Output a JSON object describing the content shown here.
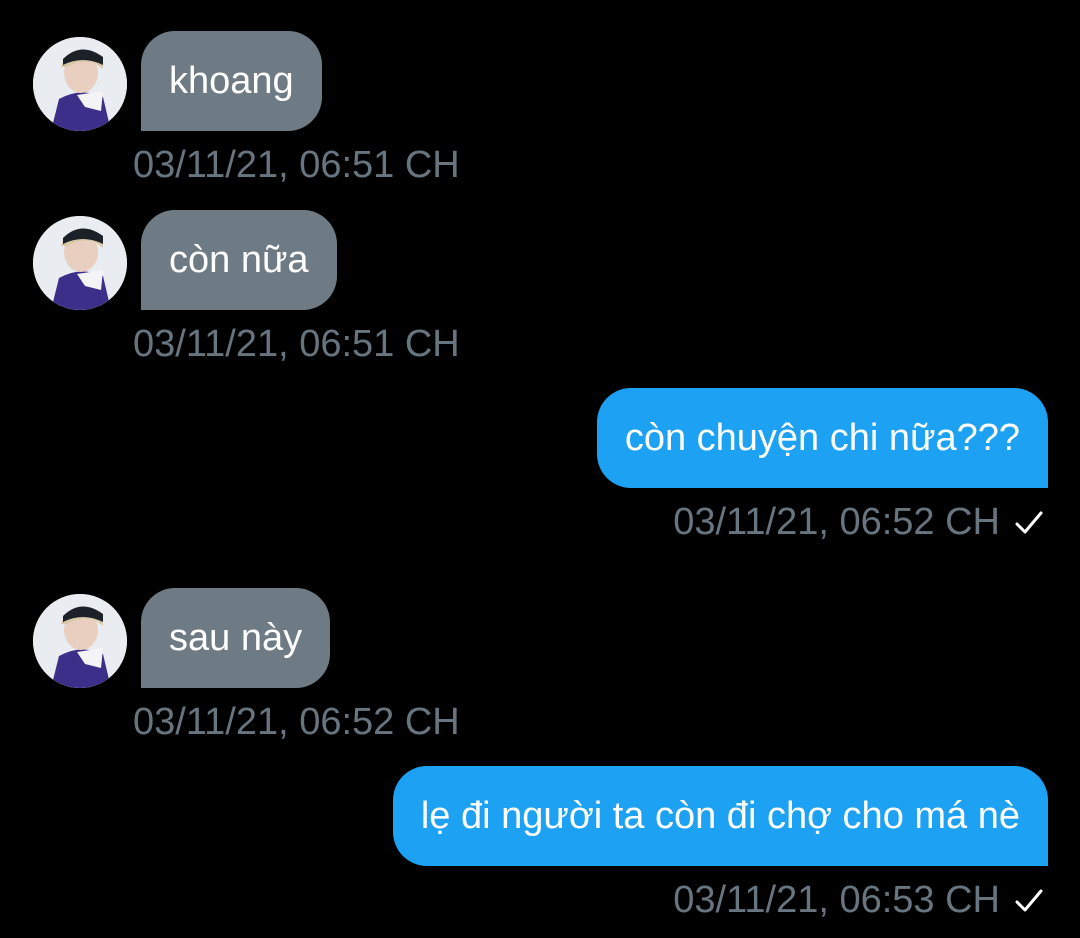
{
  "colors": {
    "background": "#000000",
    "incoming_bubble": "#6e7b85",
    "outgoing_bubble": "#1da1f2",
    "timestamp": "#66757f",
    "text": "#ffffff"
  },
  "messages": [
    {
      "direction": "incoming",
      "text": "khoang",
      "timestamp": "03/11/21, 06:51 CH",
      "avatar": "contact-avatar"
    },
    {
      "direction": "incoming",
      "text": "còn nữa",
      "timestamp": "03/11/21, 06:51 CH",
      "avatar": "contact-avatar"
    },
    {
      "direction": "outgoing",
      "text": "còn chuyện chi nữa???",
      "timestamp": "03/11/21, 06:52 CH",
      "status_icon": "check-icon"
    },
    {
      "direction": "incoming",
      "text": "sau này",
      "timestamp": "03/11/21, 06:52 CH",
      "avatar": "contact-avatar"
    },
    {
      "direction": "outgoing",
      "text": "lẹ đi người ta còn đi chợ cho má nè",
      "timestamp": "03/11/21, 06:53 CH",
      "status_icon": "check-icon"
    }
  ]
}
